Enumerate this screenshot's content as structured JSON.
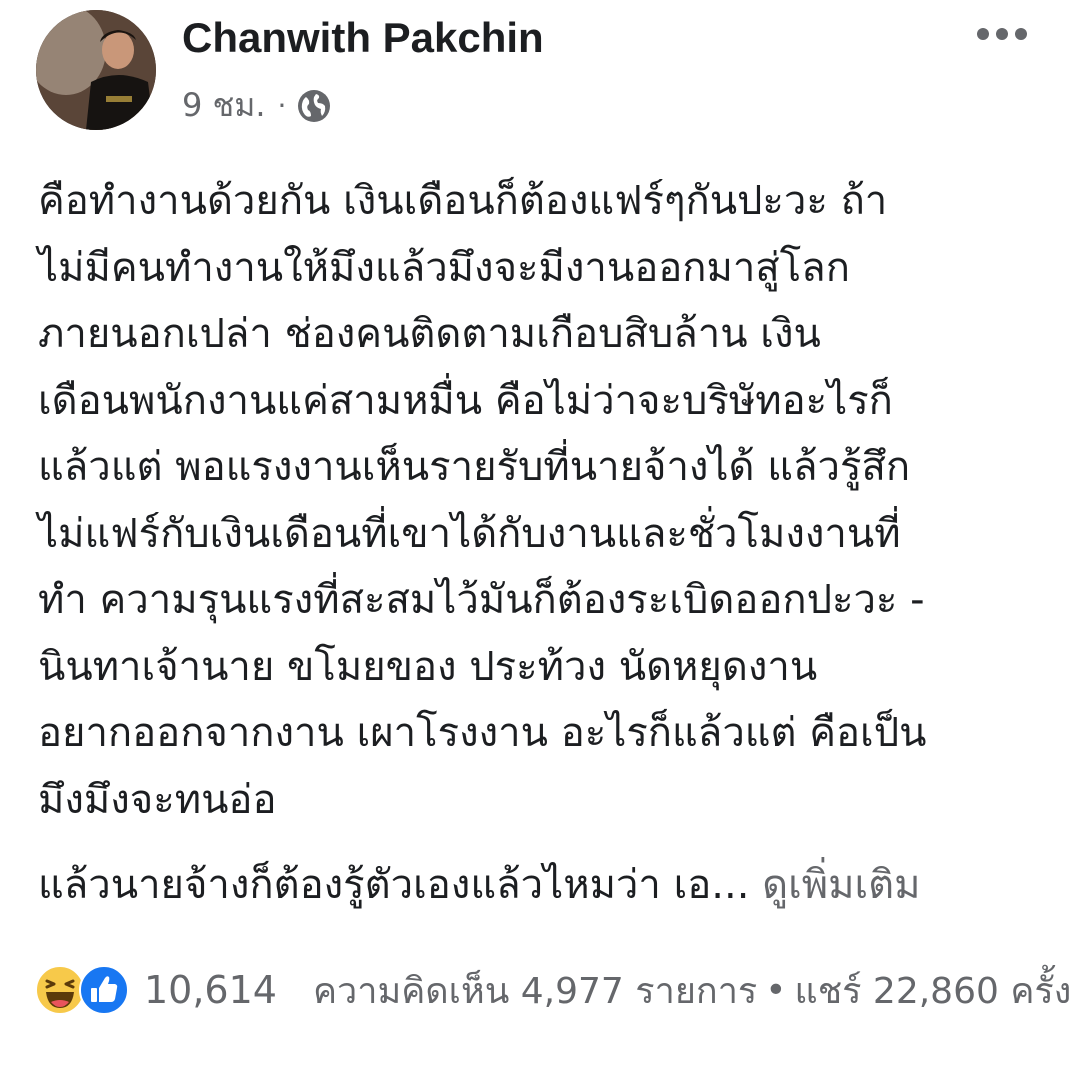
{
  "post": {
    "author": "Chanwith Pakchin",
    "time": "9 ชม.",
    "separator": "·",
    "privacy_icon": "globe-icon",
    "menu_icon": "more-options-icon",
    "body_lines": [
      "คือทำงานด้วยกัน เงินเดือนก็ต้องแฟร์ๆกันปะวะ ถ้า",
      "ไม่มีคนทำงานให้มึงแล้วมึงจะมีงานออกมาสู่โลก",
      "ภายนอกเปล่า  ช่องคนติดตามเกือบสิบล้าน เงิน",
      "เดือนพนักงานแค่สามหมื่น คือไม่ว่าจะบริษัทอะไรก็",
      "แล้วแต่ พอแรงงานเห็นรายรับที่นายจ้างได้ แล้วรู้สึก",
      "ไม่แฟร์กับเงินเดือนที่เขาได้กับงานและชั่วโมงงานที่",
      "ทำ ความรุนแรงที่สะสมไว้มันก็ต้องระเบิดออกปะวะ -",
      "นินทาเจ้านาย ขโมยของ ประท้วง นัดหยุดงาน",
      "อยากออกจากงาน เผาโรงงาน อะไรก็แล้วแต่ คือเป็น",
      "มึงมึงจะทนอ่อ"
    ],
    "truncated_line": "แล้วนายจ้างก็ต้องรู้ตัวเองแล้วไหมว่า เอ...",
    "see_more": "ดูเพิ่มเติม"
  },
  "footer": {
    "reaction_icons": [
      "haha-icon",
      "like-icon"
    ],
    "reaction_count": "10,614",
    "comments": "ความคิดเห็น 4,977 รายการ",
    "bullet": "•",
    "shares": "แชร์ 22,860 ครั้ง"
  },
  "colors": {
    "text": "#1c1e21",
    "secondary": "#65676b",
    "like_blue": "#1877f2",
    "haha_yellow": "#f7c94a"
  }
}
